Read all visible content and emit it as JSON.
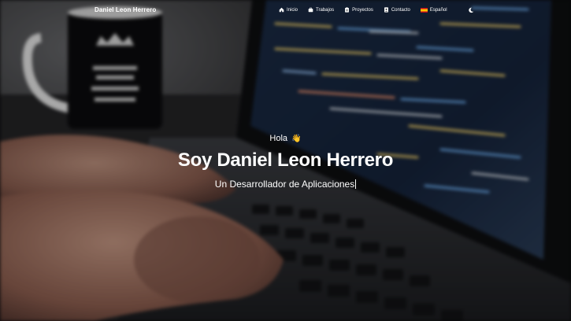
{
  "navbar": {
    "brand": "Daniel Leon Herrero",
    "items": [
      {
        "label": "Inicio",
        "icon": "home-icon"
      },
      {
        "label": "Trabajos",
        "icon": "briefcase-icon"
      },
      {
        "label": "Proyectos",
        "icon": "clipboard-icon"
      },
      {
        "label": "Contacto",
        "icon": "contact-card-icon"
      },
      {
        "label": "Español",
        "icon": "spain-flag-icon"
      }
    ],
    "theme_toggle_icon": "moon-icon"
  },
  "hero": {
    "greeting": "Hola",
    "greeting_emoji": "👋",
    "name": "Soy Daniel Leon Herrero",
    "typed_role": "Un Desarrollador de Aplicaciones"
  },
  "colors": {
    "text": "#ffffff",
    "background_dark": "#0c0c0e",
    "code_screen": "#14243e",
    "code_accent_yellow": "#e6c86a",
    "code_accent_blue": "#6aa8e8"
  }
}
